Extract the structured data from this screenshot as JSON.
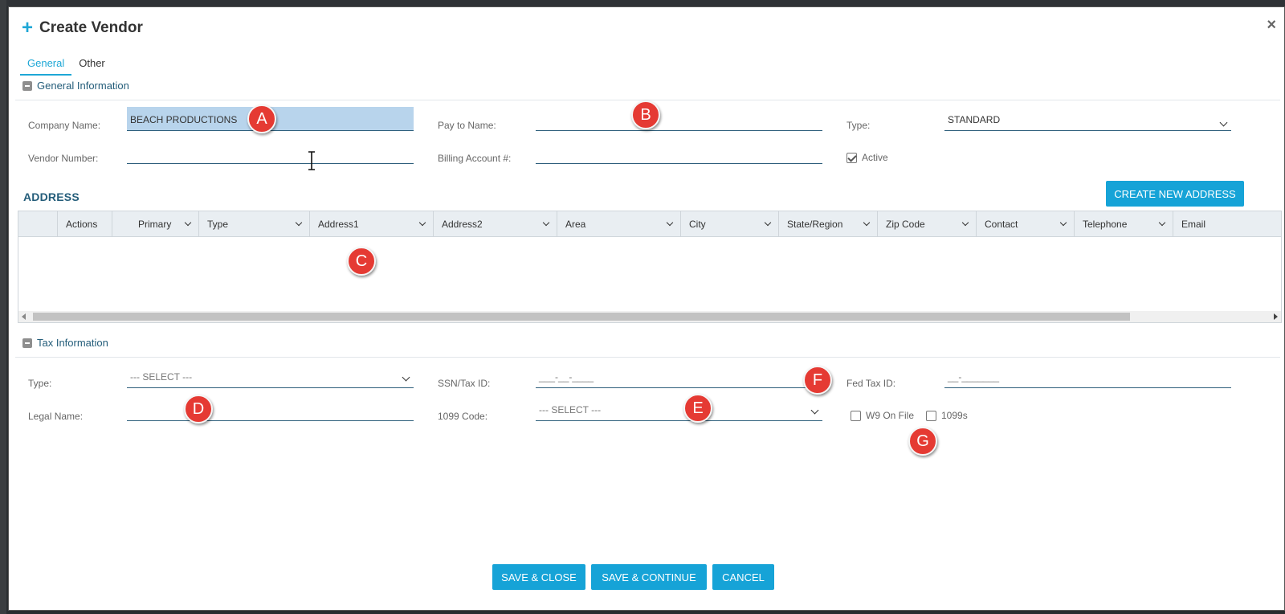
{
  "modal": {
    "title": "Create Vendor",
    "tabs": [
      "General",
      "Other"
    ],
    "active_tab": "General"
  },
  "general_info": {
    "heading": "General Information",
    "company_name_label": "Company Name:",
    "company_name_value": "BEACH PRODUCTIONS",
    "pay_to_label": "Pay to Name:",
    "pay_to_value": "",
    "type_label": "Type:",
    "type_value": "STANDARD",
    "vendor_number_label": "Vendor Number:",
    "vendor_number_value": "",
    "billing_label": "Billing Account #:",
    "billing_value": "",
    "active_label": "Active",
    "active_checked": true
  },
  "address": {
    "title": "ADDRESS",
    "create_button": "CREATE NEW ADDRESS",
    "columns": [
      "Actions",
      "Primary",
      "Type",
      "Address1",
      "Address2",
      "Area",
      "City",
      "State/Region",
      "Zip Code",
      "Contact",
      "Telephone",
      "Email"
    ],
    "rows": []
  },
  "tax_info": {
    "heading": "Tax Information",
    "type_label": "Type:",
    "type_value": "--- SELECT ---",
    "ssn_label": "SSN/Tax ID:",
    "ssn_value": "___-__-____",
    "fed_label": "Fed Tax ID:",
    "fed_value": "__-_______",
    "legal_label": "Legal Name:",
    "legal_value": "",
    "code_label": "1099 Code:",
    "code_value": "--- SELECT ---",
    "w9_label": "W9 On File",
    "w9_checked": false,
    "label_1099s": "1099s",
    "checked_1099s": false
  },
  "footer": {
    "save_close": "SAVE & CLOSE",
    "save_continue": "SAVE & CONTINUE",
    "cancel": "CANCEL"
  },
  "markers": [
    "A",
    "B",
    "C",
    "D",
    "E",
    "F",
    "G"
  ],
  "colors": {
    "accent": "#16a3d7",
    "marker": "#e53a33",
    "heading": "#245d7a"
  }
}
